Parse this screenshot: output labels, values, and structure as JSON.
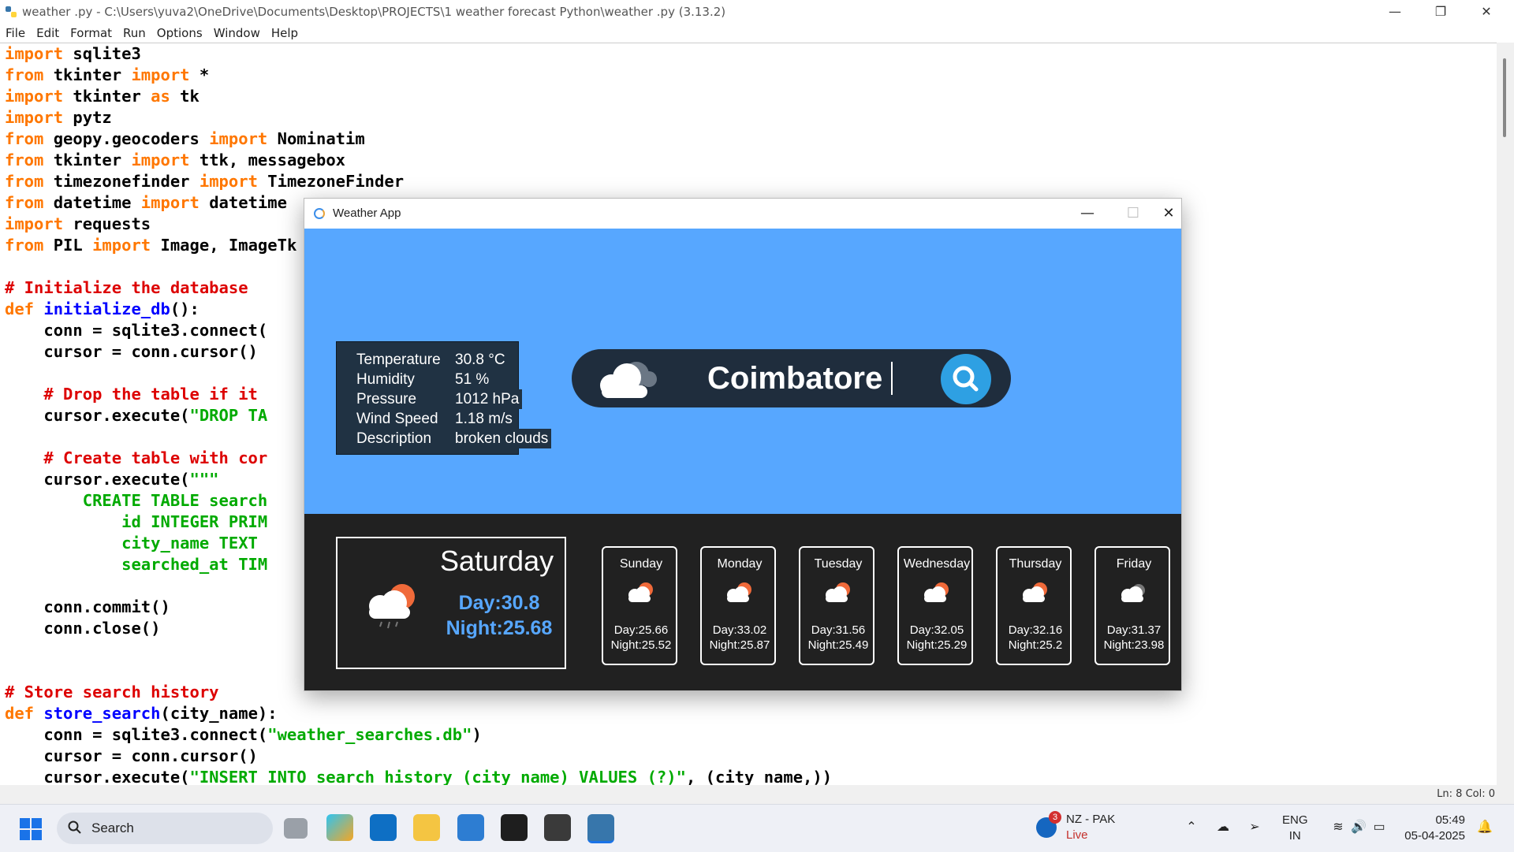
{
  "idle": {
    "title": "weather .py - C:\\Users\\yuva2\\OneDrive\\Documents\\Desktop\\PROJECTS\\1 weather forecast Python\\weather .py (3.13.2)",
    "menu": [
      "File",
      "Edit",
      "Format",
      "Run",
      "Options",
      "Window",
      "Help"
    ],
    "status": "Ln: 8   Col: 0"
  },
  "weather_app": {
    "title": "Weather App",
    "city": "Coimbatore",
    "info": {
      "labels": [
        "Temperature",
        "Humidity",
        "Pressure",
        "Wind Speed",
        "Description"
      ],
      "values": [
        "30.8 °C",
        "51 %",
        "1012 hPa",
        "1.18 m/s",
        "broken clouds"
      ]
    },
    "today": {
      "day": "Saturday",
      "day_temp": "Day:30.8",
      "night_temp": "Night:25.68"
    },
    "forecast": [
      {
        "day": "Sunday",
        "day_temp": "Day:25.66",
        "night_temp": "Night:25.52"
      },
      {
        "day": "Monday",
        "day_temp": "Day:33.02",
        "night_temp": "Night:25.87"
      },
      {
        "day": "Tuesday",
        "day_temp": "Day:31.56",
        "night_temp": "Night:25.49"
      },
      {
        "day": "Wednesday",
        "day_temp": "Day:32.05",
        "night_temp": "Night:25.29"
      },
      {
        "day": "Thursday",
        "day_temp": "Day:32.16",
        "night_temp": "Night:25.2"
      },
      {
        "day": "Friday",
        "day_temp": "Day:31.37",
        "night_temp": "Night:23.98"
      }
    ],
    "colors": {
      "top_bg": "#57a7ff",
      "bottom_bg": "#212121",
      "accent": "#57a7ff"
    }
  },
  "taskbar": {
    "search_label": "Search",
    "news_title": "NZ - PAK",
    "news_status": "Live",
    "news_badge": "3",
    "lang": "ENG",
    "region": "IN",
    "time": "05:49",
    "date": "05-04-2025"
  }
}
